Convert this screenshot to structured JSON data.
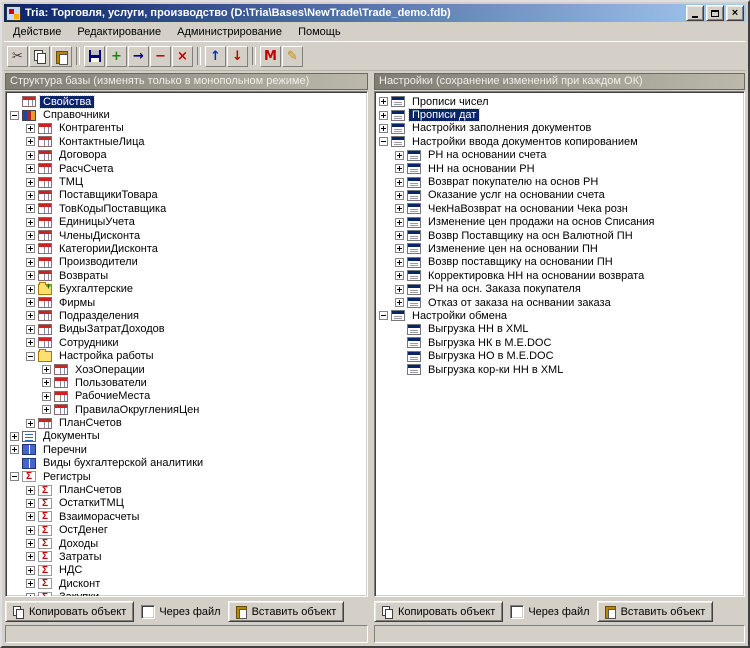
{
  "window": {
    "title": "Tria: Торговля, услуги, производство  (D:\\Tria\\Bases\\NewTrade\\Trade_demo.fdb)"
  },
  "menu": {
    "items": [
      "Действие",
      "Редактирование",
      "Администрирование",
      "Помощь"
    ]
  },
  "toolbar": {
    "buttons": [
      {
        "name": "cut",
        "glyph": "✂",
        "color": "#3a3a3a"
      },
      {
        "name": "copy",
        "shape": "copy"
      },
      {
        "name": "paste",
        "shape": "paste"
      },
      {
        "sep": true
      },
      {
        "name": "save",
        "shape": "save"
      },
      {
        "name": "add",
        "glyph": "+",
        "color": "#0b8a0b"
      },
      {
        "name": "insert",
        "glyph": "→",
        "color": "#000090"
      },
      {
        "name": "delete",
        "glyph": "−",
        "color": "#c00000"
      },
      {
        "name": "cancel",
        "glyph": "×",
        "color": "#c00000"
      },
      {
        "sep": true
      },
      {
        "name": "move-up",
        "glyph": "↑",
        "color": "#0030c0"
      },
      {
        "name": "move-down",
        "glyph": "↓",
        "color": "#c00000"
      },
      {
        "sep": true
      },
      {
        "name": "memo",
        "glyph": "M",
        "color": "#c00000"
      },
      {
        "name": "wizard",
        "glyph": "✎",
        "color": "#c78a00"
      }
    ]
  },
  "left_panel": {
    "header": "Структура базы (изменять только в монопольном режиме)",
    "footer": {
      "copy_label": "Копировать объект",
      "via_file_label": "Через файл",
      "paste_label": "Вставить объект"
    },
    "tree": [
      {
        "label": "Свойства",
        "icon": "table-red",
        "exp": null,
        "selected": true
      },
      {
        "label": "Справочники",
        "icon": "books",
        "exp": "minus",
        "children": [
          {
            "label": "Контрагенты",
            "icon": "table-red",
            "exp": "plus"
          },
          {
            "label": "КонтактныеЛица",
            "icon": "table-red",
            "exp": "plus"
          },
          {
            "label": "Договора",
            "icon": "table-red",
            "exp": "plus"
          },
          {
            "label": "РасчСчета",
            "icon": "table-red",
            "exp": "plus"
          },
          {
            "label": "ТМЦ",
            "icon": "table-red",
            "exp": "plus"
          },
          {
            "label": "ПоставщикиТовара",
            "icon": "table-red",
            "exp": "plus"
          },
          {
            "label": "ТовКодыПоставщика",
            "icon": "table-red",
            "exp": "plus"
          },
          {
            "label": "ЕдиницыУчета",
            "icon": "table-red",
            "exp": "plus"
          },
          {
            "label": "ЧленыДисконта",
            "icon": "table-red",
            "exp": "plus"
          },
          {
            "label": "КатегорииДисконта",
            "icon": "table-red",
            "exp": "plus"
          },
          {
            "label": "Производители",
            "icon": "table-red",
            "exp": "plus"
          },
          {
            "label": "Возвраты",
            "icon": "table-red",
            "exp": "plus"
          },
          {
            "label": "Бухгалтерские",
            "icon": "folder-plus",
            "exp": "plus"
          },
          {
            "label": "Фирмы",
            "icon": "table-red",
            "exp": "plus"
          },
          {
            "label": "Подразделения",
            "icon": "table-red",
            "exp": "plus"
          },
          {
            "label": "ВидыЗатратДоходов",
            "icon": "table-red",
            "exp": "plus"
          },
          {
            "label": "Сотрудники",
            "icon": "table-red",
            "exp": "plus"
          },
          {
            "label": "Настройка работы",
            "icon": "folder",
            "exp": "minus",
            "children": [
              {
                "label": "ХозОперации",
                "icon": "table-red",
                "exp": "plus"
              },
              {
                "label": "Пользователи",
                "icon": "table-red",
                "exp": "plus"
              },
              {
                "label": "РабочиеМеста",
                "icon": "table-red",
                "exp": "plus"
              },
              {
                "label": "ПравилаОкругленияЦен",
                "icon": "table-red",
                "exp": "plus"
              }
            ]
          },
          {
            "label": "ПланСчетов",
            "icon": "table-red",
            "exp": "plus"
          }
        ]
      },
      {
        "label": "Документы",
        "icon": "docs",
        "exp": "plus"
      },
      {
        "label": "Перечни",
        "icon": "book-blue",
        "exp": "plus"
      },
      {
        "label": "Виды бухгалтерской аналитики",
        "icon": "book-blue",
        "exp": null
      },
      {
        "label": "Регистры",
        "icon": "sigma",
        "exp": "minus",
        "children": [
          {
            "label": "ПланСчетов",
            "icon": "sigma",
            "exp": "plus"
          },
          {
            "label": "ОстаткиТМЦ",
            "icon": "sigma",
            "exp": "plus"
          },
          {
            "label": "Взаиморасчеты",
            "icon": "sigma",
            "exp": "plus"
          },
          {
            "label": "ОстДенег",
            "icon": "sigma",
            "exp": "plus"
          },
          {
            "label": "Доходы",
            "icon": "sigma",
            "exp": "plus"
          },
          {
            "label": "Затраты",
            "icon": "sigma",
            "exp": "plus"
          },
          {
            "label": "НДС",
            "icon": "sigma",
            "exp": "plus"
          },
          {
            "label": "Дисконт",
            "icon": "sigma",
            "exp": "plus"
          },
          {
            "label": "Закупки",
            "icon": "sigma",
            "exp": "plus"
          }
        ]
      }
    ]
  },
  "right_panel": {
    "header": "Настройки (сохранение изменений при каждом ОК)",
    "footer": {
      "copy_label": "Копировать объект",
      "via_file_label": "Через файл",
      "paste_label": "Вставить объект"
    },
    "tree": [
      {
        "label": "Прописи чисел",
        "icon": "form",
        "exp": "plus"
      },
      {
        "label": "Прописи дат",
        "icon": "form",
        "exp": "plus",
        "selected": true
      },
      {
        "label": "Настройки заполнения документов",
        "icon": "form",
        "exp": "plus"
      },
      {
        "label": "Настройки ввода документов копированием",
        "icon": "form",
        "exp": "minus",
        "children": [
          {
            "label": "РН на основании счета",
            "icon": "form",
            "exp": "plus"
          },
          {
            "label": "НН на основании РН",
            "icon": "form",
            "exp": "plus"
          },
          {
            "label": "Возврат покупателю на основ РН",
            "icon": "form",
            "exp": "plus"
          },
          {
            "label": "Оказание услг на основании счета",
            "icon": "form",
            "exp": "plus"
          },
          {
            "label": "ЧекНаВозврат на основании Чека розн",
            "icon": "form",
            "exp": "plus"
          },
          {
            "label": "Изменение цен продажи на основ Списания",
            "icon": "form",
            "exp": "plus"
          },
          {
            "label": "Возвр Поставщику на осн Валютной ПН",
            "icon": "form",
            "exp": "plus"
          },
          {
            "label": "Изменение цен на основании ПН",
            "icon": "form",
            "exp": "plus"
          },
          {
            "label": "Возвр поставщику на основании ПН",
            "icon": "form",
            "exp": "plus"
          },
          {
            "label": "Корректировка НН на основании возврата",
            "icon": "form",
            "exp": "plus"
          },
          {
            "label": "РН на осн. Заказа покупателя",
            "icon": "form",
            "exp": "plus"
          },
          {
            "label": "Отказ от заказа на оснвании заказа",
            "icon": "form",
            "exp": "plus"
          }
        ]
      },
      {
        "label": "Настройки обмена",
        "icon": "form",
        "exp": "minus",
        "children": [
          {
            "label": "Выгрузка НН в XML",
            "icon": "form",
            "exp": null
          },
          {
            "label": "Выгрузка НК в M.E.DOC",
            "icon": "form",
            "exp": null
          },
          {
            "label": "Выгрузка НО в M.E.DOC",
            "icon": "form",
            "exp": null
          },
          {
            "label": "Выгрузка кор-ки НН в XML",
            "icon": "form",
            "exp": null
          }
        ]
      }
    ]
  }
}
